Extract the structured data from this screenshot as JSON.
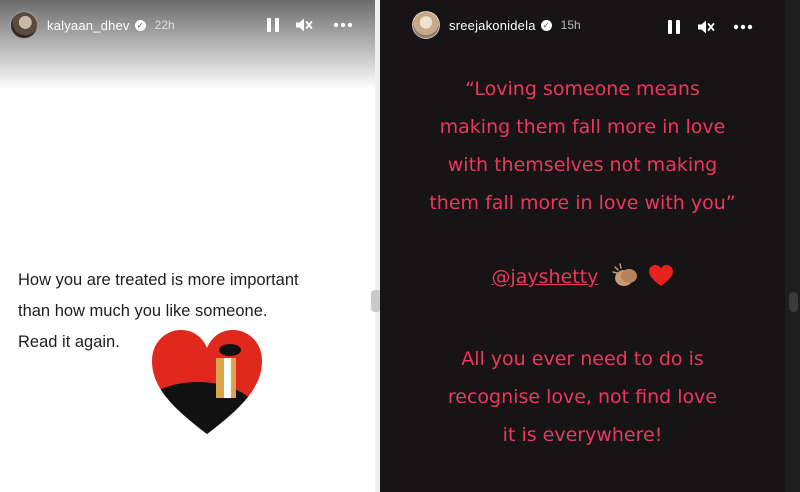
{
  "left_story": {
    "username": "kalyaan_dhev",
    "time": "22h",
    "text_lines": [
      "How you are treated is more important",
      "than how much you like someone.",
      "Read it again."
    ]
  },
  "right_story": {
    "username": "sreejakonidela",
    "time": "15h",
    "quote": "“Loving someone means\nmaking them fall more in love\nwith themselves not making\nthem fall more in love with you”",
    "mention": "@jayshetty",
    "ending": "All you ever need to do is\nrecognise love, not find love\nit is everywhere!"
  },
  "icons": {
    "verified": "verified-badge-icon",
    "pause": "pause-icon",
    "mute": "speaker-muted-icon",
    "more": "more-options-icon",
    "clap": "clapping-hands-emoji",
    "heart": "red-heart-emoji",
    "sticker": "heart-sticker"
  },
  "colors": {
    "quote_text": "#f0365f",
    "right_background": "#161414",
    "left_background": "#ffffff"
  }
}
